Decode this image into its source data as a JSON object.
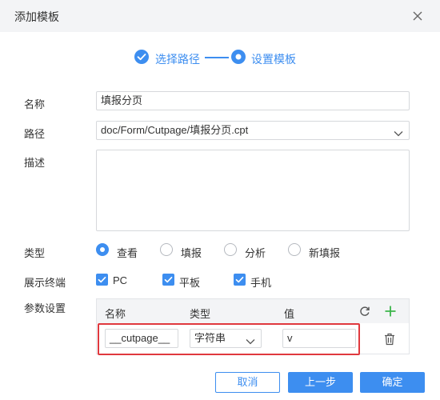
{
  "dialog": {
    "title": "添加模板"
  },
  "steps": [
    {
      "label": "选择路径",
      "state": "done"
    },
    {
      "label": "设置模板",
      "state": "current"
    }
  ],
  "form": {
    "name_label": "名称",
    "name_value": "填报分页",
    "path_label": "路径",
    "path_value": "doc/Form/Cutpage/填报分页.cpt",
    "desc_label": "描述",
    "desc_value": "",
    "type_label": "类型",
    "type_options": [
      {
        "label": "查看",
        "selected": true
      },
      {
        "label": "填报",
        "selected": false
      },
      {
        "label": "分析",
        "selected": false
      },
      {
        "label": "新填报",
        "selected": false
      }
    ],
    "terminal_label": "展示终端",
    "terminal_options": [
      {
        "label": "PC",
        "checked": true
      },
      {
        "label": "平板",
        "checked": true
      },
      {
        "label": "手机",
        "checked": true
      }
    ],
    "params_label": "参数设置"
  },
  "params_table": {
    "headers": [
      "名称",
      "类型",
      "值"
    ],
    "rows": [
      {
        "name": "__cutpage__",
        "type": "字符串",
        "value": "v"
      }
    ]
  },
  "buttons": {
    "cancel": "取消",
    "prev": "上一步",
    "confirm": "确定"
  },
  "icons": {
    "close": "close-icon",
    "refresh": "refresh-icon",
    "add": "plus-icon",
    "delete": "trash-icon",
    "dropdown": "chevron-down-icon",
    "check": "check-icon"
  },
  "colors": {
    "accent": "#3d8ef0",
    "highlight": "#e0393e",
    "add": "#3bb54a"
  }
}
